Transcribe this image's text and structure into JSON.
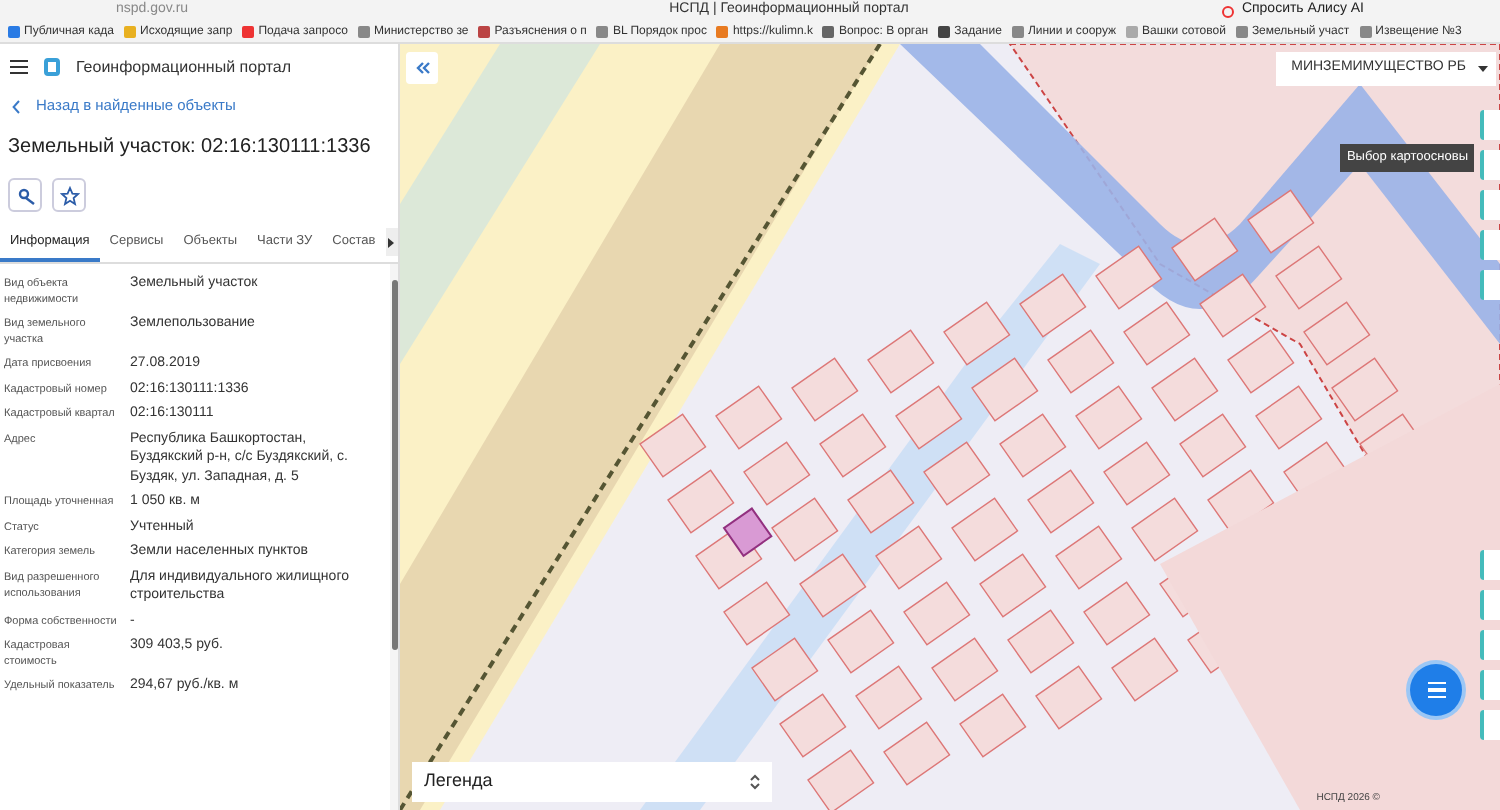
{
  "browser": {
    "url": "nspd.gov.ru",
    "title": "НСПД | Геоинформационный портал",
    "assistant": "Спросить Алису AI",
    "bookmarks": [
      "Публичная када",
      "Исходящие запр",
      "Подача запросо",
      "Министерство зе",
      "Разъяснения о п",
      "BL Порядок прос",
      "https://kulimn.k",
      "Вопрос: В орган",
      "Задание",
      "Линии и сооруж",
      "Вашки сотовой",
      "Земельный участ",
      "Извещение №3"
    ]
  },
  "app": {
    "title": "Геоинформационный портал"
  },
  "panel": {
    "back": "Назад в найденные объекты",
    "heading": "Земельный участок: 02:16:130111:1336",
    "tabs": [
      {
        "label": "Информация",
        "selected": true
      },
      {
        "label": "Сервисы",
        "selected": false
      },
      {
        "label": "Объекты",
        "selected": false
      },
      {
        "label": "Части ЗУ",
        "selected": false
      },
      {
        "label": "Состав",
        "selected": false
      }
    ],
    "fields": [
      {
        "label": "Вид объекта недвижимости",
        "value": "Земельный участок"
      },
      {
        "label": "Вид земельного участка",
        "value": "Землепользование"
      },
      {
        "label": "Дата присвоения",
        "value": "27.08.2019"
      },
      {
        "label": "Кадастровый номер",
        "value": "02:16:130111:1336"
      },
      {
        "label": "Кадастровый квартал",
        "value": "02:16:130111"
      },
      {
        "label": "Адрес",
        "value": "Республика Башкортостан, Буздякский р-н, с/с Буздякский, с. Буздяк, ул. Западная, д. 5"
      },
      {
        "label": "Площадь уточненная",
        "value": "1 050 кв. м"
      },
      {
        "label": "Статус",
        "value": "Учтенный"
      },
      {
        "label": "Категория земель",
        "value": "Земли населенных пунктов"
      },
      {
        "label": "Вид разрешенного использования",
        "value": "Для индивидуального жилищного строительства"
      },
      {
        "label": "Форма собственности",
        "value": "-"
      },
      {
        "label": "Кадастровая стоимость",
        "value": "309 403,5 руб."
      },
      {
        "label": "Удельный показатель",
        "value": "294,67 руб./кв. м"
      }
    ]
  },
  "map": {
    "source": "МИНЗЕМИМУЩЕСТВО РБ",
    "tooltip": "Выбор картоосновы",
    "legend": "Легенда",
    "copyright": "НСПД 2026 ©"
  }
}
